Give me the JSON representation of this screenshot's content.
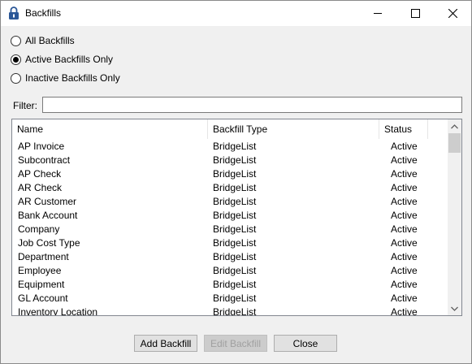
{
  "window": {
    "title": "Backfills",
    "icon": "padlock-icon"
  },
  "filter_options": [
    {
      "label": "All Backfills",
      "checked": false
    },
    {
      "label": "Active Backfills Only",
      "checked": true
    },
    {
      "label": "Inactive Backfills Only",
      "checked": false
    }
  ],
  "filter": {
    "label": "Filter:",
    "value": ""
  },
  "list": {
    "columns": [
      "Name",
      "Backfill Type",
      "Status"
    ],
    "rows": [
      [
        "AP Invoice",
        "BridgeList",
        "Active"
      ],
      [
        "Subcontract",
        "BridgeList",
        "Active"
      ],
      [
        "AP Check",
        "BridgeList",
        "Active"
      ],
      [
        "AR Check",
        "BridgeList",
        "Active"
      ],
      [
        "AR Customer",
        "BridgeList",
        "Active"
      ],
      [
        "Bank Account",
        "BridgeList",
        "Active"
      ],
      [
        "Company",
        "BridgeList",
        "Active"
      ],
      [
        "Job Cost Type",
        "BridgeList",
        "Active"
      ],
      [
        "Department",
        "BridgeList",
        "Active"
      ],
      [
        "Employee",
        "BridgeList",
        "Active"
      ],
      [
        "Equipment",
        "BridgeList",
        "Active"
      ],
      [
        "GL Account",
        "BridgeList",
        "Active"
      ],
      [
        "Inventory Location",
        "BridgeList",
        "Active"
      ]
    ]
  },
  "buttons": {
    "add": "Add Backfill",
    "edit": "Edit Backfill",
    "close": "Close",
    "edit_enabled": false
  }
}
